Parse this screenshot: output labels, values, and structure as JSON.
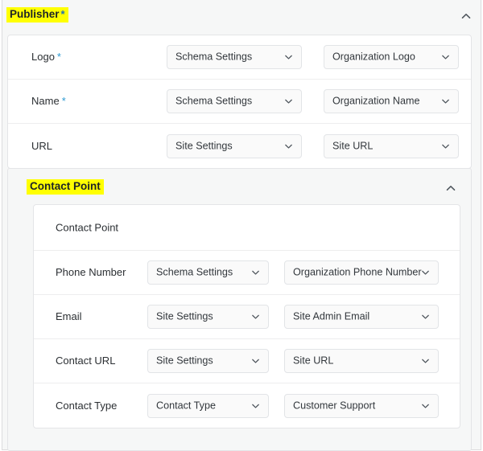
{
  "publisher_section": {
    "title": "Publisher",
    "required_marker": "*",
    "collapse_icon": "chevron-up-icon",
    "rows": [
      {
        "label": "Logo",
        "required_marker": "*",
        "source_select": "Schema Settings",
        "value_select": "Organization Logo"
      },
      {
        "label": "Name",
        "required_marker": "*",
        "source_select": "Schema Settings",
        "value_select": "Organization Name"
      },
      {
        "label": "URL",
        "required_marker": "",
        "source_select": "Site Settings",
        "value_select": "Site URL"
      }
    ]
  },
  "contact_point_section": {
    "title": "Contact Point",
    "collapse_icon": "chevron-up-icon",
    "card_heading": "Contact Point",
    "rows": [
      {
        "label": "Phone Number",
        "source_select": "Schema Settings",
        "value_select": "Organization Phone Number"
      },
      {
        "label": "Email",
        "source_select": "Site Settings",
        "value_select": "Site Admin Email"
      },
      {
        "label": "Contact URL",
        "source_select": "Site Settings",
        "value_select": "Site URL"
      },
      {
        "label": "Contact Type",
        "source_select": "Contact Type",
        "value_select": "Customer Support"
      }
    ]
  },
  "colors": {
    "highlight": "#ffff00",
    "required_asterisk": "#2d9ad2",
    "panel_background": "#f6f7f7",
    "card_background": "#ffffff",
    "border": "#e4e5e7",
    "text": "#32373c"
  }
}
